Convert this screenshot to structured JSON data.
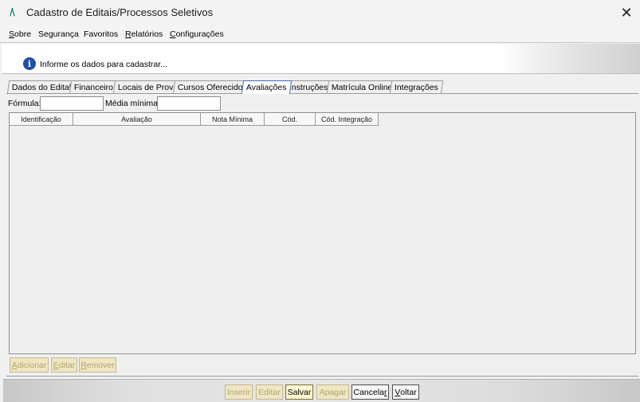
{
  "window": {
    "title": "Cadastro de Editais/Processos Seletivos",
    "logo_text": "/\\",
    "close_symbol": "✕"
  },
  "menu": [
    {
      "pre": "",
      "u": "S",
      "post": "obre"
    },
    {
      "pre": "Segurança",
      "u": "",
      "post": ""
    },
    {
      "pre": "Favoritos",
      "u": "",
      "post": ""
    },
    {
      "pre": "",
      "u": "R",
      "post": "elatórios"
    },
    {
      "pre": "",
      "u": "C",
      "post": "onfigurações"
    }
  ],
  "info": {
    "icon": "info-icon",
    "symbol": "i",
    "message": "Informe os dados para cadastrar..."
  },
  "tabs": [
    "Dados do Edital",
    "Financeiro",
    "Locais de Prova",
    "Cursos Oferecidos",
    "Avaliações",
    "Instruções",
    "Matrícula Online",
    "Integrações"
  ],
  "active_tab": "Avaliações",
  "form": {
    "formula_label": "Fórmula:",
    "formula_value": "",
    "media_label": "Média mínima:",
    "media_value": ""
  },
  "grid": {
    "columns": [
      "Identificação",
      "Avaliação",
      "Nota Mínima",
      "Cód.",
      "Cód. Integração"
    ],
    "rows": []
  },
  "grid_buttons": {
    "adicionar": {
      "u": "A",
      "rest": "dicionar"
    },
    "editar": {
      "u": "E",
      "rest": "ditar"
    },
    "remover": {
      "u": "R",
      "rest": "emover"
    }
  },
  "footer_buttons": {
    "inserir": "Inserir",
    "editar": "Editar",
    "salvar": "Salvar",
    "apagar": "Apagar",
    "cancelar": {
      "pre": "Cancela",
      "u": "r"
    },
    "voltar": {
      "u": "V",
      "rest": "oltar"
    }
  },
  "colors": {
    "accent": "#3d6cc0",
    "info_icon": "#1f4fa8",
    "button_enabled_bg": "#fff7cf",
    "button_disabled_bg": "#efe6c3"
  }
}
